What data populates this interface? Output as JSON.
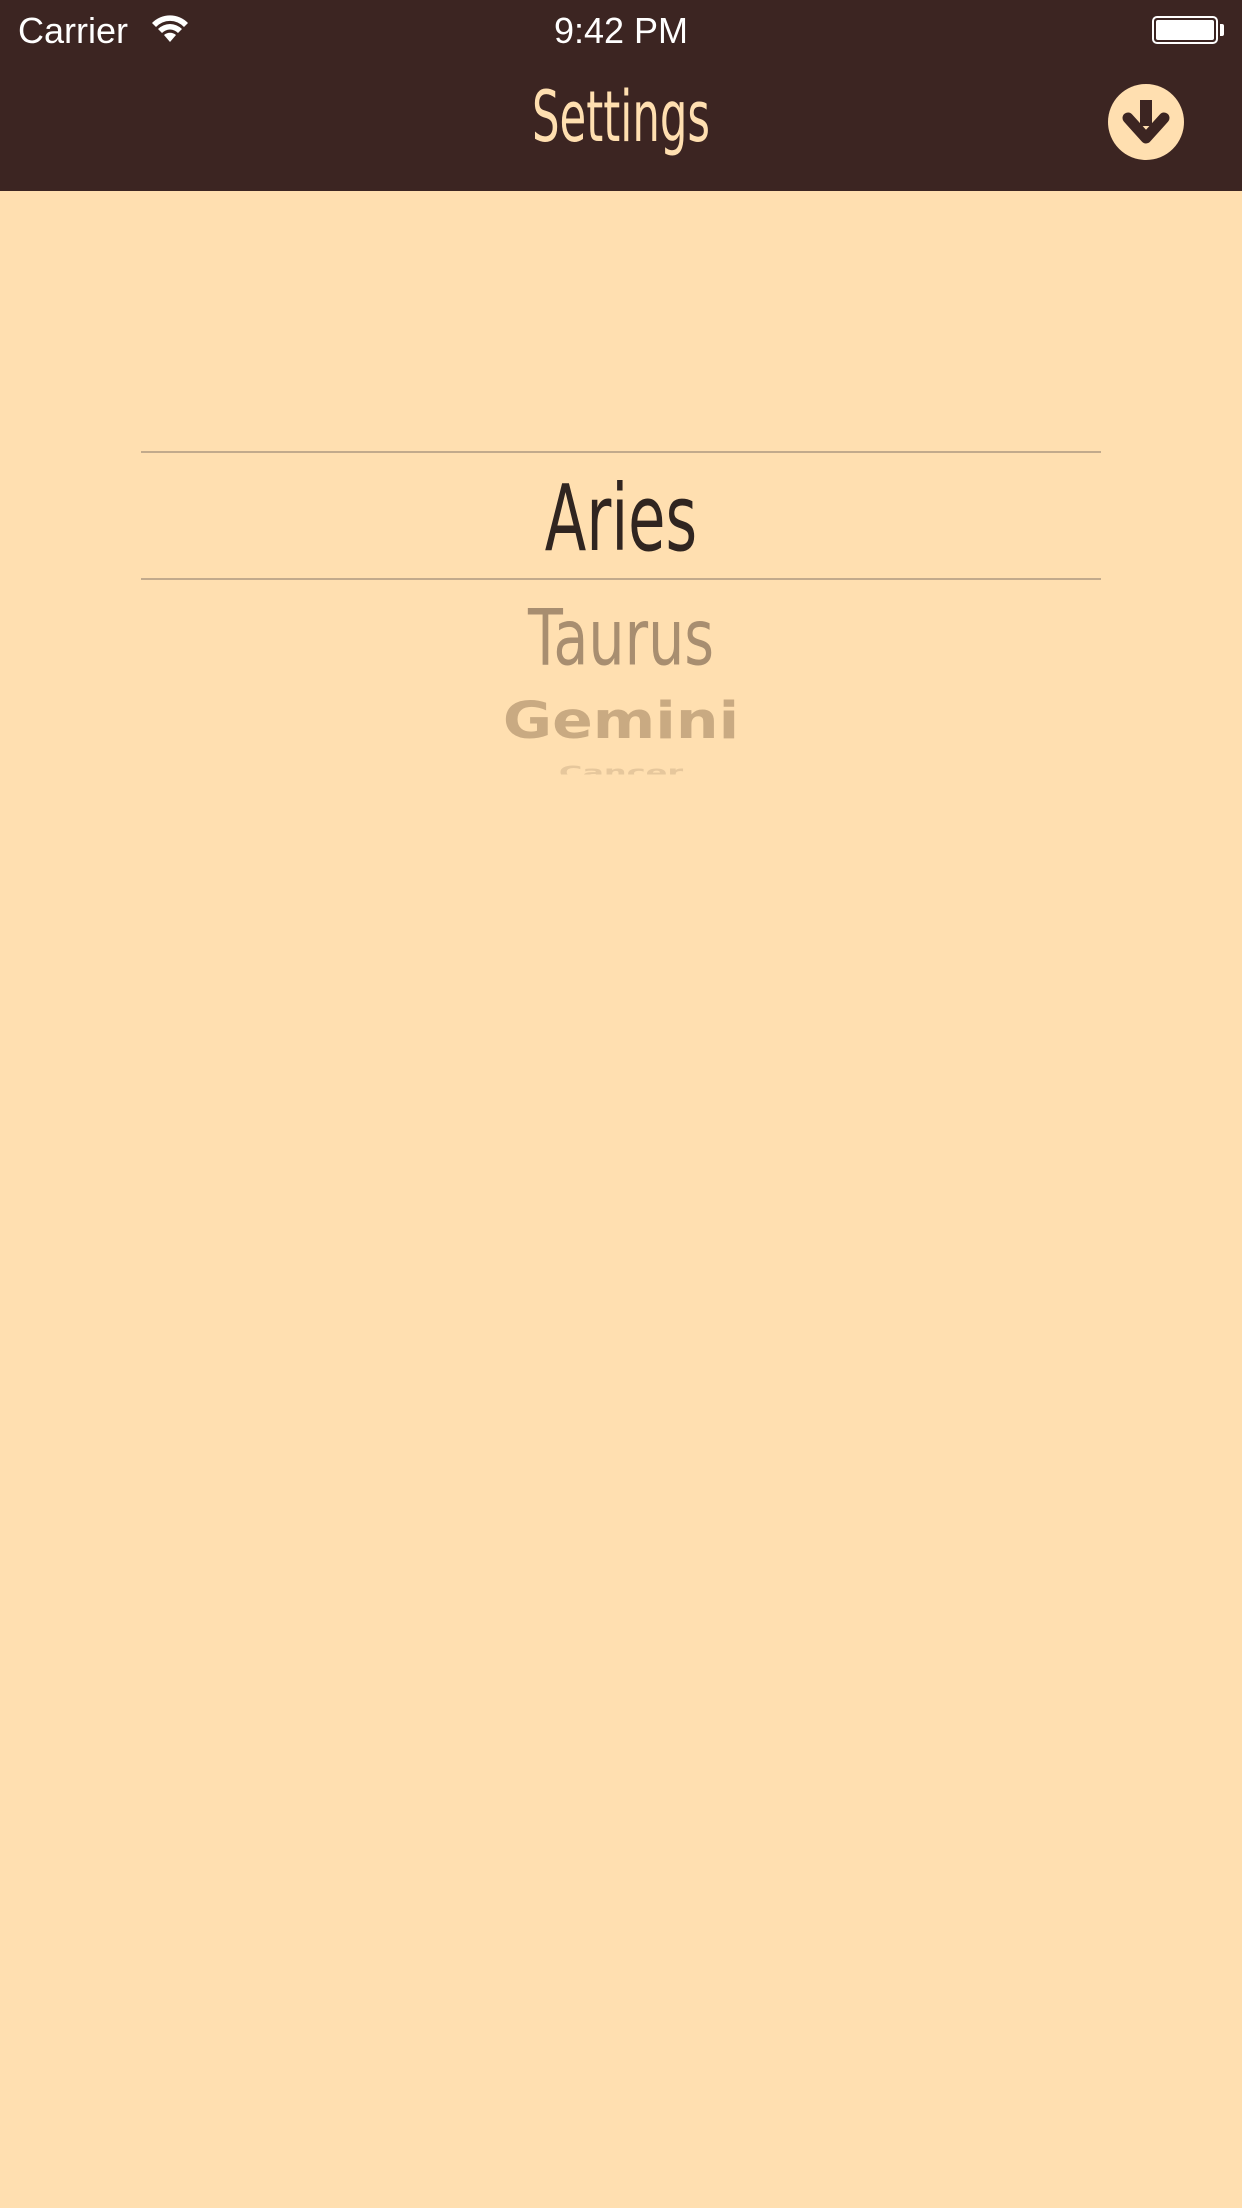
{
  "status_bar": {
    "carrier": "Carrier",
    "time": "9:42 PM",
    "battery_level": 1.0
  },
  "nav_bar": {
    "title": "Settings",
    "action_icon": "download-circle-icon"
  },
  "picker": {
    "items": [
      "Aries",
      "Taurus",
      "Gemini",
      "Cancer"
    ],
    "selected": "Aries"
  },
  "colors": {
    "nav_background": "#3C2522",
    "page_background": "#FFDFB0",
    "accent": "#FFDFB0",
    "selected_text": "#302520"
  }
}
